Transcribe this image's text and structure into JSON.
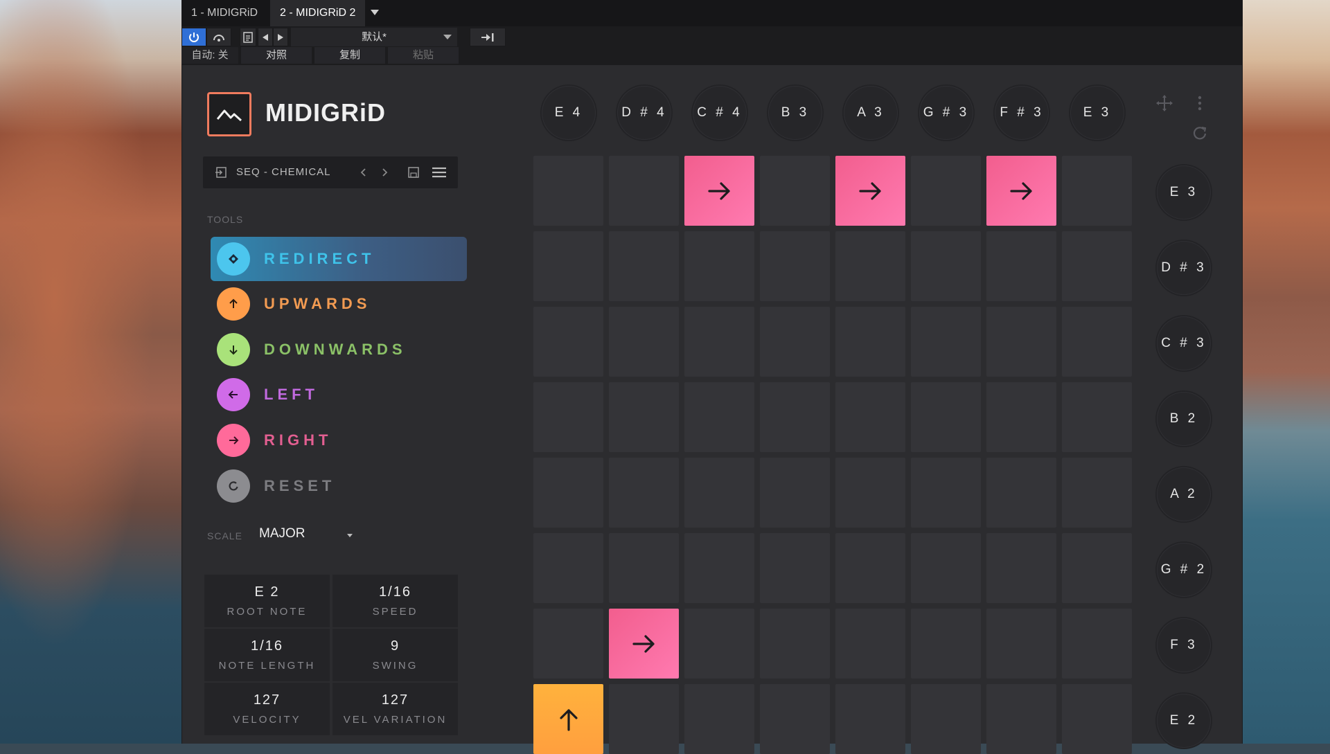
{
  "host": {
    "tabs": [
      {
        "label": "1 - MIDIGRiD",
        "active": false
      },
      {
        "label": "2 - MIDIGRiD 2",
        "active": true
      }
    ],
    "preset": "默认*",
    "auto_label": "自动: 关",
    "compare_label": "对照",
    "copy_label": "复制",
    "paste_label": "粘贴"
  },
  "plugin": {
    "brand": "MIDIGRiD",
    "preset_name": "SEQ - CHEMICAL",
    "tools_label": "TOOLS",
    "tools": [
      {
        "label": "REDIRECT",
        "color": "#4cc6ee",
        "text_color": "#3fc3ea",
        "active": true
      },
      {
        "label": "UPWARDS",
        "color": "#ff9d4a",
        "text_color": "#f29b52",
        "active": false
      },
      {
        "label": "DOWNWARDS",
        "color": "#a9e27a",
        "text_color": "#8bc167",
        "active": false
      },
      {
        "label": "LEFT",
        "color": "#d06be8",
        "text_color": "#c16adf",
        "active": false
      },
      {
        "label": "RIGHT",
        "color": "#ff6a9a",
        "text_color": "#e35f91",
        "active": false
      },
      {
        "label": "RESET",
        "color": "#8c8c90",
        "text_color": "#7c7c80",
        "active": false
      }
    ],
    "scale_label": "SCALE",
    "scale_value": "MAJOR",
    "params": [
      {
        "value": "E 2",
        "label": "ROOT NOTE"
      },
      {
        "value": "1/16",
        "label": "SPEED"
      },
      {
        "value": "1/16",
        "label": "NOTE LENGTH"
      },
      {
        "value": "9",
        "label": "SWING"
      },
      {
        "value": "127",
        "label": "VELOCITY"
      },
      {
        "value": "127",
        "label": "VEL VARIATION"
      }
    ],
    "top_notes": [
      "E 4",
      "D # 4",
      "C # 4",
      "B 3",
      "A 3",
      "G # 3",
      "F # 3",
      "E 3"
    ],
    "side_notes": [
      "E 3",
      "D # 3",
      "C # 3",
      "B 2",
      "A 2",
      "G # 2",
      "F 3",
      "E 2"
    ],
    "grid": [
      [
        "",
        "",
        "right",
        "",
        "right",
        "",
        "right",
        ""
      ],
      [
        "",
        "",
        "",
        "",
        "",
        "",
        "",
        ""
      ],
      [
        "",
        "",
        "",
        "",
        "",
        "",
        "",
        ""
      ],
      [
        "",
        "",
        "",
        "",
        "",
        "",
        "",
        ""
      ],
      [
        "",
        "",
        "",
        "",
        "",
        "",
        "",
        ""
      ],
      [
        "",
        "",
        "",
        "",
        "",
        "",
        "",
        ""
      ],
      [
        "",
        "right",
        "",
        "",
        "",
        "",
        "",
        ""
      ],
      [
        "up",
        "",
        "",
        "",
        "",
        "",
        "",
        ""
      ]
    ]
  }
}
